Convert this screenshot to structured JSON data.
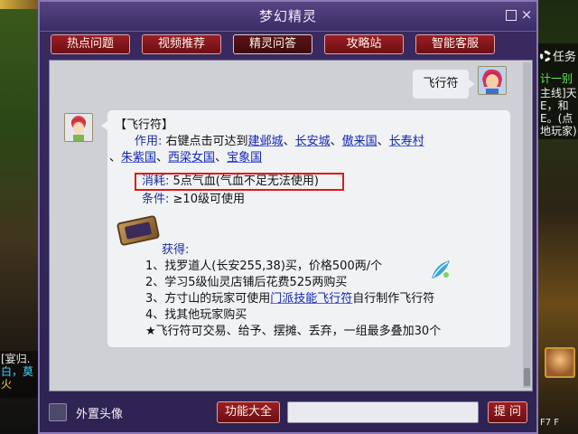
{
  "window": {
    "title": "梦幻精灵",
    "close_label": "×"
  },
  "tabs": [
    {
      "label": "热点问题"
    },
    {
      "label": "视频推荐"
    },
    {
      "label": "精灵问答"
    },
    {
      "label": "攻略站"
    },
    {
      "label": "智能客服"
    }
  ],
  "user_message": "飞行符",
  "bot_reply": {
    "title": "【飞行符】",
    "use_label": "作用:",
    "use_prefix": "右键点击可达到",
    "cities": [
      "建邺城",
      "长安城",
      "傲来国",
      "长寿村",
      "朱紫国",
      "西梁女国",
      "宝象国"
    ],
    "city_sep": "、",
    "cost_label": "消耗:",
    "cost_text": "5点气血(气血不足无法使用)",
    "condition_label": "条件:",
    "condition_text": "≥10级可使用",
    "obtain_label": "获得:",
    "obtain_items": [
      "1、找罗道人(长安255,38)买，价格500两/个",
      "2、学习5级仙灵店铺后花费525两购买",
      "4、找其他玩家购买",
      "★飞行符可交易、给予、摆摊、丢弃，一组最多叠加30个"
    ],
    "obtain_3_prefix": "3、方寸山的玩家可使用",
    "obtain_3_link": "门派技能飞行符",
    "obtain_3_suffix": "自行制作飞行符"
  },
  "bottom": {
    "avatar_toggle_label": "外置头像",
    "features_button": "功能大全",
    "input_value": "",
    "ask_button": "提 问"
  },
  "background": {
    "task_title": "任务",
    "task_lines": [
      "计一别",
      "主线]天",
      "E，和",
      "E。(点",
      "地玩家)"
    ],
    "chat_lines": [
      "[宴归.",
      "白，莫",
      "火"
    ],
    "corner_text": "F7 F"
  },
  "colors": {
    "dialog_bg": "#2e2352",
    "tab_red": "#8a1a1f",
    "link_blue": "#1326b6",
    "highlight_red": "#e01818"
  }
}
